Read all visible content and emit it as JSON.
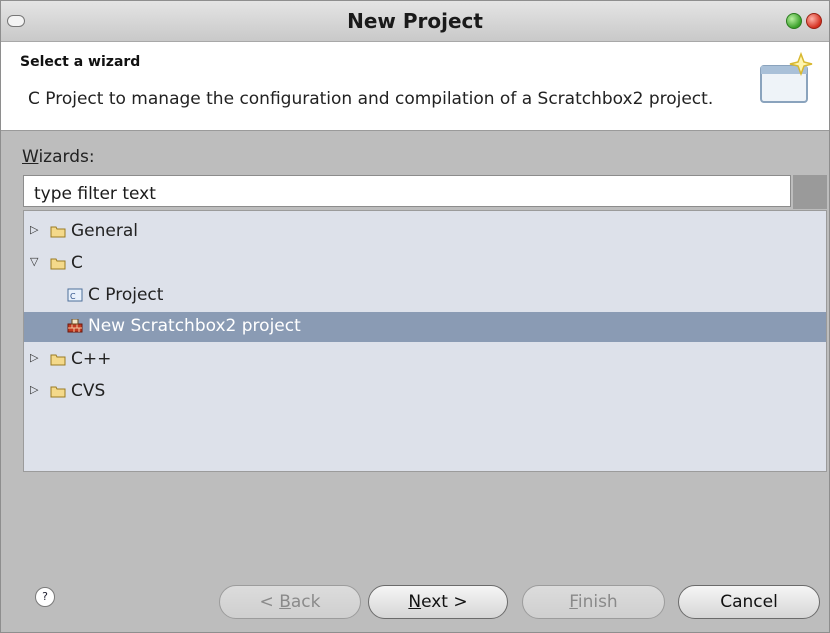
{
  "window": {
    "title": "New Project"
  },
  "header": {
    "title": "Select a wizard",
    "description": "C Project to manage the configuration and compilation of a Scratchbox2 project."
  },
  "wizards": {
    "label_mnemonic": "W",
    "label_rest": "izards:",
    "filter_value": "type filter text"
  },
  "tree": {
    "items": [
      {
        "label": "General",
        "expanded": false,
        "type": "folder"
      },
      {
        "label": "C",
        "expanded": true,
        "type": "folder"
      },
      {
        "label": "C Project",
        "type": "c-project"
      },
      {
        "label": "New Scratchbox2 project",
        "type": "scratchbox",
        "selected": true
      },
      {
        "label": "C++",
        "expanded": false,
        "type": "folder"
      },
      {
        "label": "CVS",
        "expanded": false,
        "type": "folder"
      }
    ]
  },
  "buttons": {
    "back": {
      "prefix": "< ",
      "mnemonic": "B",
      "rest": "ack",
      "enabled": false
    },
    "next": {
      "mnemonic": "N",
      "rest": "ext >",
      "enabled": true
    },
    "finish": {
      "mnemonic": "F",
      "rest": "inish",
      "enabled": false
    },
    "cancel": {
      "label": "Cancel",
      "enabled": true
    },
    "help": {
      "glyph": "?"
    }
  },
  "colors": {
    "selection": "#8a9bb4",
    "tree_background": "#dde1ea",
    "dialog_background": "#bdbdbd"
  }
}
